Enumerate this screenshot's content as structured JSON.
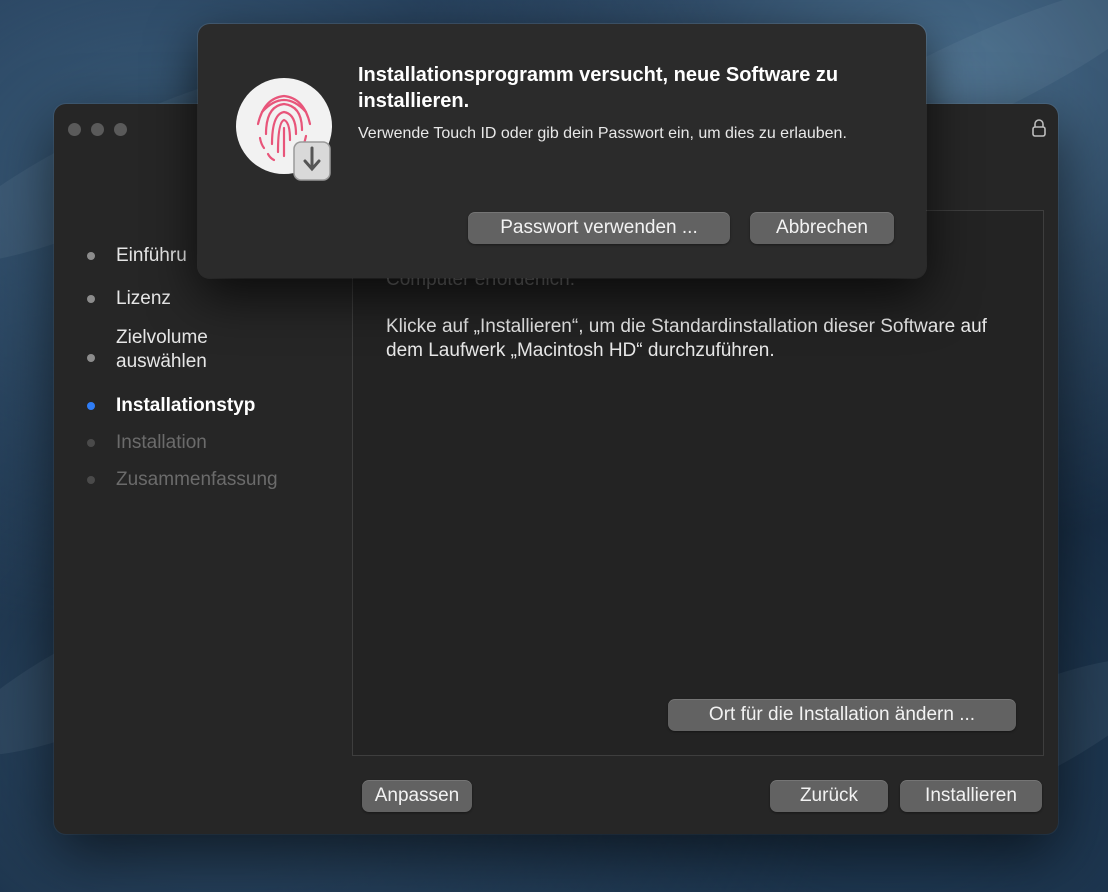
{
  "dialog": {
    "title": "Installationsprogramm versucht, neue Software zu installieren.",
    "message": "Verwende Touch ID oder gib dein Passwort ein, um dies zu erlauben.",
    "use_password_label": "Passwort verwenden ...",
    "cancel_label": "Abbrechen",
    "icon": "touch-id-fingerprint-icon"
  },
  "window": {
    "lock_icon": "lock-icon"
  },
  "sidebar": {
    "steps": [
      {
        "label": "Einführu",
        "state": "done"
      },
      {
        "label": "Lizenz",
        "state": "done"
      },
      {
        "label": "Zielvolume auswählen",
        "state": "done"
      },
      {
        "label": "Installationstyp",
        "state": "active"
      },
      {
        "label": "Installation",
        "state": "pending"
      },
      {
        "label": "Zusammenfassung",
        "state": "pending"
      }
    ]
  },
  "main": {
    "faded_text": "Computer erforderlich.",
    "body_text": "Klicke auf „Installieren“, um die Standardinstallation dieser Software auf dem Laufwerk „Macintosh HD“ durchzuführen.",
    "change_location_label": "Ort für die Installation ändern ..."
  },
  "footer": {
    "customize_label": "Anpassen",
    "back_label": "Zurück",
    "install_label": "Installieren"
  },
  "colors": {
    "accent": "#2f7df6",
    "window_bg": "#262626",
    "button_bg": "#626262"
  }
}
